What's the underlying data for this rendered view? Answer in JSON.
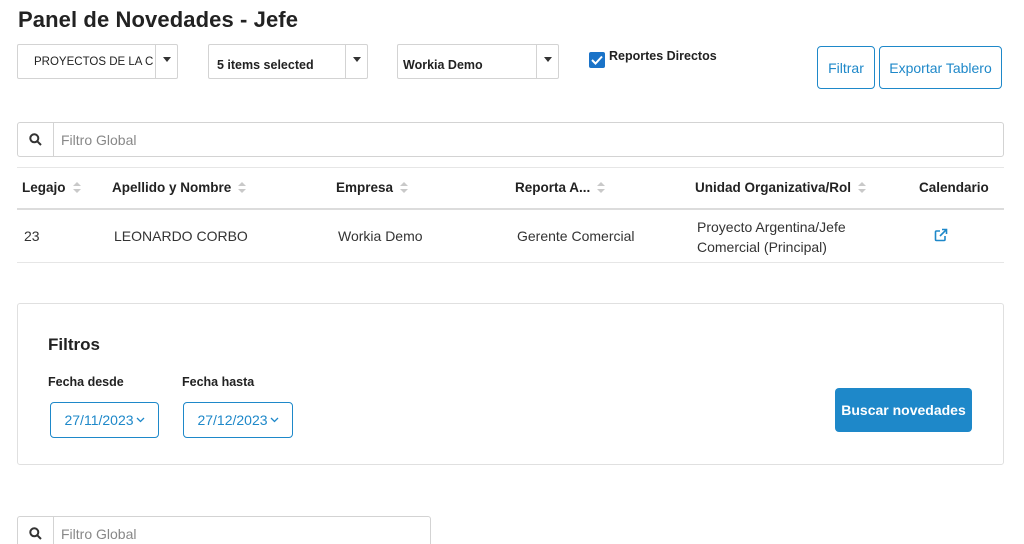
{
  "page": {
    "title": "Panel de Novedades - Jefe"
  },
  "toolbar": {
    "select_project": "PROYECTOS DE LA C",
    "select_items": "5 items selected",
    "select_company": "Workia Demo",
    "reportes_directos_label": "Reportes Directos",
    "reportes_directos_checked": true,
    "filtrar_label": "Filtrar",
    "exportar_label": "Exportar Tablero"
  },
  "search1": {
    "placeholder": "Filtro Global"
  },
  "table": {
    "columns": [
      "Legajo",
      "Apellido y Nombre",
      "Empresa",
      "Reporta A...",
      "Unidad Organizativa/Rol",
      "Calendario"
    ],
    "rows": [
      {
        "legajo": "23",
        "nombre": "LEONARDO CORBO",
        "empresa": "Workia Demo",
        "reporta": "Gerente Comercial",
        "unidad_line1": "Proyecto Argentina/Jefe",
        "unidad_line2": "Comercial (Principal)",
        "calendario_icon": "external-link-icon"
      }
    ]
  },
  "filters": {
    "title": "Filtros",
    "fecha_desde_label": "Fecha desde",
    "fecha_desde_value": "27/11/2023",
    "fecha_hasta_label": "Fecha hasta",
    "fecha_hasta_value": "27/12/2023",
    "buscar_label": "Buscar novedades"
  },
  "search2": {
    "placeholder": "Filtro Global"
  },
  "colors": {
    "accent": "#1e88c9",
    "checkbox": "#1a73c8"
  }
}
